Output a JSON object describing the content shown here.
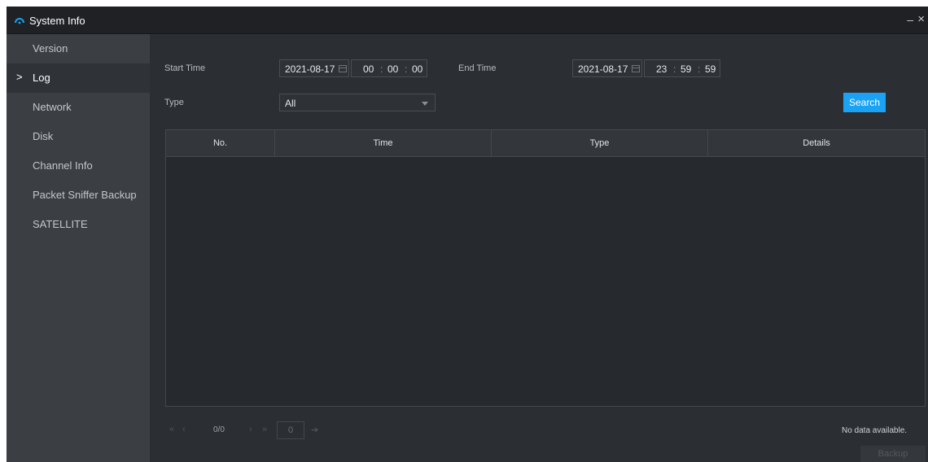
{
  "window": {
    "title": "System Info",
    "minimize_label": "–",
    "close_label": "×"
  },
  "sidebar": {
    "items": [
      {
        "label": "Version",
        "active": false
      },
      {
        "label": "Log",
        "active": true
      },
      {
        "label": "Network",
        "active": false
      },
      {
        "label": "Disk",
        "active": false
      },
      {
        "label": "Channel Info",
        "active": false
      },
      {
        "label": "Packet Sniffer Backup",
        "active": false
      },
      {
        "label": "SATELLITE",
        "active": false
      }
    ],
    "active_marker": ">"
  },
  "filters": {
    "start_label": "Start Time",
    "start_date": "2021-08-17",
    "start_hh": "00",
    "start_mm": "00",
    "start_ss": "00",
    "end_label": "End Time",
    "end_date": "2021-08-17",
    "end_hh": "23",
    "end_mm": "59",
    "end_ss": "59",
    "time_separator": ":",
    "type_label": "Type",
    "type_value": "All",
    "search_label": "Search"
  },
  "table": {
    "columns": [
      "No.",
      "Time",
      "Type",
      "Details"
    ],
    "rows": []
  },
  "pagination": {
    "first": "«",
    "prev": "‹",
    "count": "0/0",
    "next": "›",
    "last": "»",
    "page_input": "0",
    "go": "➔"
  },
  "status": {
    "no_data": "No data available.",
    "backup_label": "Backup"
  },
  "colors": {
    "accent": "#1aa3f5",
    "background": "#2b2e33",
    "sidebar": "#3b3e43",
    "titlebar": "#1f2125"
  }
}
